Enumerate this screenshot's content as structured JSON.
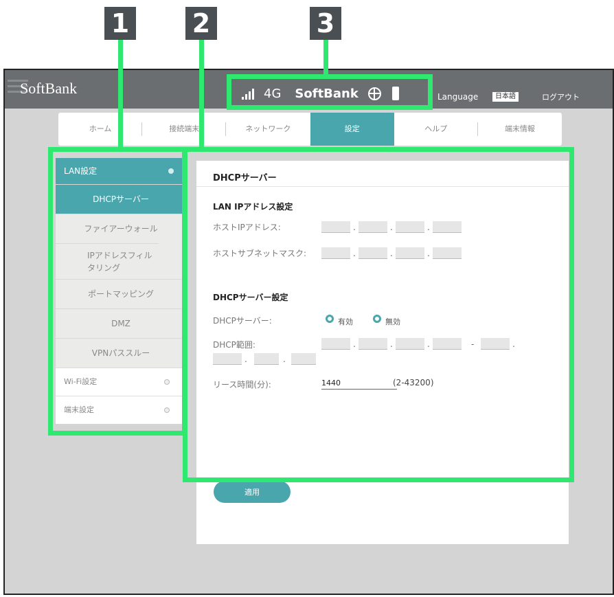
{
  "callouts": [
    "1",
    "2",
    "3"
  ],
  "header": {
    "logo": "SoftBank",
    "network": "4G",
    "carrier": "SoftBank",
    "language_label": "Language",
    "language_value": "日本語",
    "logout": "ログアウト"
  },
  "nav": {
    "tabs": [
      "ホーム",
      "接続端末",
      "ネットワーク",
      "設定",
      "ヘルプ",
      "端末情報"
    ],
    "active": "設定"
  },
  "sidebar": {
    "section": "LAN設定",
    "subitems": [
      "DHCPサーバー",
      "ファイアーウォール",
      "IPアドレスフィルタリング",
      "ポートマッピング",
      "DMZ",
      "VPNパススルー"
    ],
    "items": [
      "Wi-Fi設定",
      "端末設定"
    ]
  },
  "panel": {
    "title": "DHCPサーバー",
    "lan_section": "LAN IPアドレス設定",
    "host_ip_label": "ホストIPアドレス:",
    "subnet_label": "ホストサブネットマスク:",
    "dhcp_section": "DHCPサーバー設定",
    "dhcp_server_label": "DHCPサーバー:",
    "radio_enable": "有効",
    "radio_disable": "無効",
    "dhcp_range_label": "DHCP範囲:",
    "lease_label": "リース時間(分):",
    "lease_value": "1440",
    "lease_range": "(2-43200)",
    "apply": "適用"
  },
  "colors": {
    "accent": "#4aa6ad",
    "highlight": "#2ee870",
    "header": "#6b6e70"
  }
}
